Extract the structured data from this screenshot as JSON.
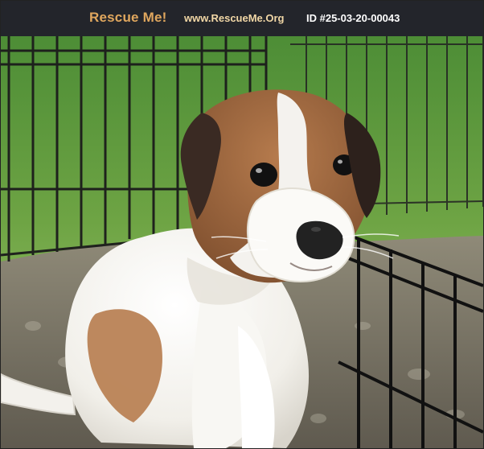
{
  "header": {
    "brand": "Rescue Me!",
    "site": "www.RescueMe.Org",
    "pet_id": "ID #25-03-20-00043"
  },
  "colors": {
    "header_bg": "#23252b",
    "brand": "#e0a75e",
    "site": "#f1d7a6",
    "pet_id": "#ffffff"
  },
  "photo": {
    "subject": "puppy-photo"
  }
}
